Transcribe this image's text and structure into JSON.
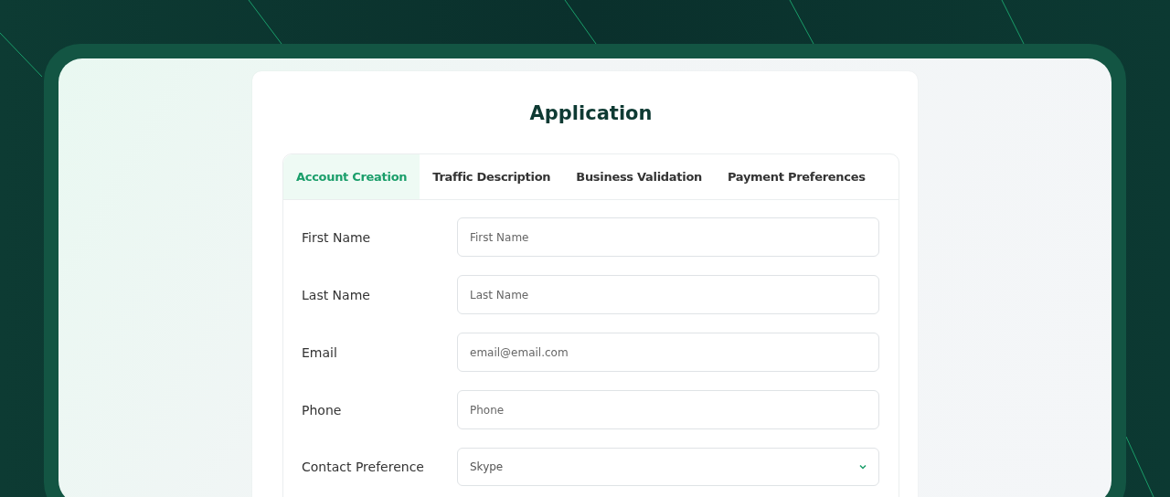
{
  "title": "Application",
  "tabs": [
    {
      "label": "Account Creation",
      "selected": true
    },
    {
      "label": "Traffic Description",
      "selected": false
    },
    {
      "label": "Business Validation",
      "selected": false
    },
    {
      "label": "Payment Preferences",
      "selected": false
    }
  ],
  "fields": [
    {
      "kind": "input",
      "label": "First Name",
      "placeholder": "First Name"
    },
    {
      "kind": "input",
      "label": "Last Name",
      "placeholder": "Last Name"
    },
    {
      "kind": "input",
      "label": "Email",
      "placeholder": "email@email.com"
    },
    {
      "kind": "input",
      "label": "Phone",
      "placeholder": "Phone"
    },
    {
      "kind": "select",
      "label": "Contact Preference",
      "value": "Skype"
    }
  ]
}
